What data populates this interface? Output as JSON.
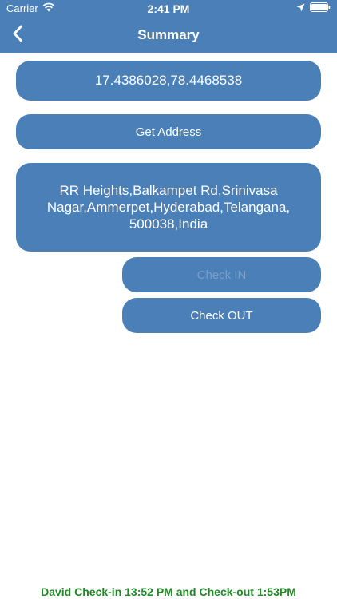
{
  "status_bar": {
    "carrier": "Carrier",
    "time": "2:41 PM"
  },
  "nav": {
    "title": "Summary",
    "back_icon": "chevron-left-icon"
  },
  "main": {
    "coordinates": "17.4386028,78.4468538",
    "get_address_label": "Get Address",
    "address": "RR Heights,Balkampet Rd,Srinivasa Nagar,Ammerpet,Hyderabad,Telangana, 500038,India",
    "check_in_label": "Check IN",
    "check_in_enabled": false,
    "check_out_label": "Check OUT"
  },
  "footer": {
    "status_text": "David Check-in 13:52 PM and Check-out 1:53PM"
  },
  "colors": {
    "primary": "#4a7fb7",
    "footer_text": "#1e8a23",
    "disabled_text": "#7c9ec7"
  }
}
